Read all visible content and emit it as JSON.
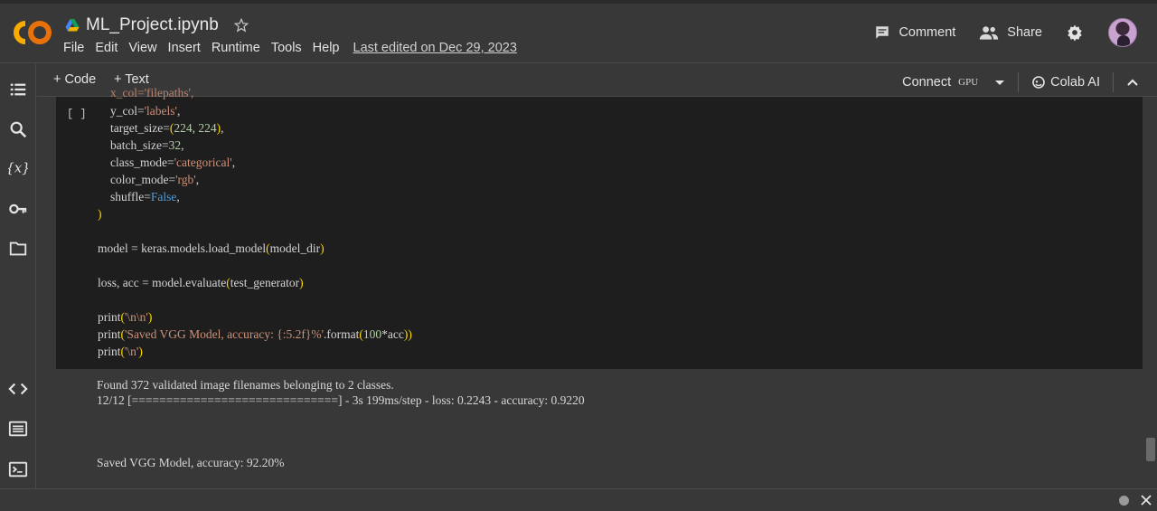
{
  "header": {
    "logo_text": "CO",
    "notebook_title": "ML_Project.ipynb",
    "menu": [
      "File",
      "Edit",
      "View",
      "Insert",
      "Runtime",
      "Tools",
      "Help"
    ],
    "last_edited": "Last edited on Dec 29, 2023",
    "comment_label": "Comment",
    "share_label": "Share"
  },
  "toolbar": {
    "add_code_label": "+ Code",
    "add_text_label": "+ Text",
    "connect_label": "Connect",
    "gpu_label": "GPU",
    "colab_ai_label": "Colab AI"
  },
  "sidebar_icons": [
    "table-of-contents-icon",
    "search-icon",
    "variables-icon",
    "secrets-key-icon",
    "files-folder-icon",
    "code-snippets-icon",
    "command-palette-icon",
    "terminal-icon"
  ],
  "cell": {
    "run_indicator": "[ ]",
    "code_lines": [
      "x_col='filepaths',",
      "y_col='labels',",
      "target_size=(224, 224),",
      "batch_size=32,",
      "class_mode='categorical',",
      "color_mode='rgb',",
      "shuffle=False,",
      ")",
      "model = keras.models.load_model(model_dir)",
      "loss, acc = model.evaluate(test_generator)",
      "print('\\n\\n')",
      "print('Saved VGG Model, accuracy: {:5.2f}%'.format(100*acc))",
      "print('\\n')"
    ]
  },
  "output": {
    "lines": [
      "Found 372 validated image filenames belonging to 2 classes.",
      "12/12 [==============================] - 3s 199ms/step - loss: 0.2243 - accuracy: 0.9220",
      "Saved VGG Model, accuracy: 92.20%"
    ]
  },
  "colors": {
    "background": "#383838",
    "cell_background": "#1e1e1e",
    "string": "#ce9178",
    "number": "#b5cea8",
    "keyword": "#569cd6",
    "bracket": "#ffd700",
    "logo_orange": "#f9ab00"
  }
}
